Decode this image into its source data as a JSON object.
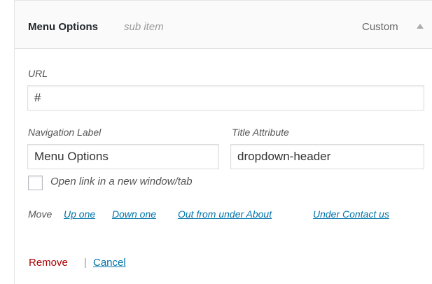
{
  "item": {
    "title": "Menu Options",
    "subtitle": "sub item",
    "type_label": "Custom"
  },
  "url": {
    "label": "URL",
    "value": "#"
  },
  "nav_label": {
    "label": "Navigation Label",
    "value": "Menu Options"
  },
  "title_attr": {
    "label": "Title Attribute",
    "value": "dropdown-header"
  },
  "new_window": {
    "label": "Open link in a new window/tab",
    "checked": false
  },
  "move": {
    "label": "Move",
    "links": [
      "Up one",
      "Down one",
      "Out from under About",
      "Under Contact us"
    ]
  },
  "actions": {
    "remove": "Remove",
    "separator": "|",
    "cancel": "Cancel"
  },
  "colors": {
    "link": "#0073aa",
    "remove": "#aa0000"
  }
}
